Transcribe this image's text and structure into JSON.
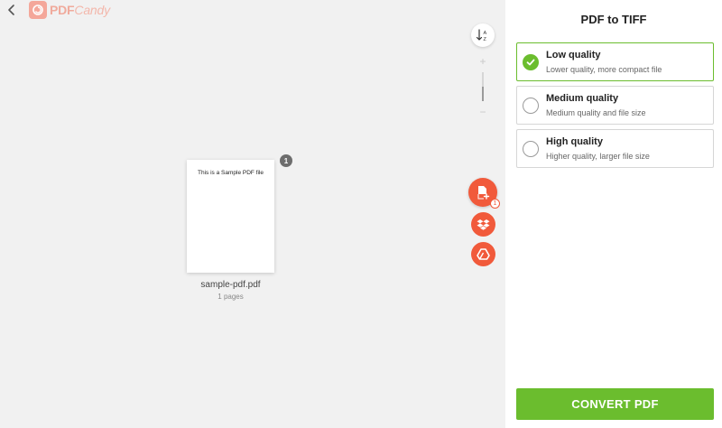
{
  "header": {
    "logo_main": "PDF",
    "logo_accent": "Candy"
  },
  "toolbar": {
    "sort_icon": "sort-az-icon",
    "zoom_plus": "+",
    "zoom_minus": "−"
  },
  "file": {
    "content_preview": "This is a Sample PDF file",
    "page_badge": "1",
    "name": "sample-pdf.pdf",
    "pages": "1 pages"
  },
  "actions": {
    "add_file_count": "1"
  },
  "panel": {
    "title": "PDF to TIFF",
    "options": [
      {
        "label": "Low quality",
        "description": "Lower quality, more compact file",
        "selected": true
      },
      {
        "label": "Medium quality",
        "description": "Medium quality and file size",
        "selected": false
      },
      {
        "label": "High quality",
        "description": "Higher quality, larger file size",
        "selected": false
      }
    ],
    "convert_label": "CONVERT PDF"
  },
  "colors": {
    "accent_green": "#6bbd2e",
    "accent_orange": "#f15a3b",
    "logo_pink": "#f0aa9c"
  }
}
